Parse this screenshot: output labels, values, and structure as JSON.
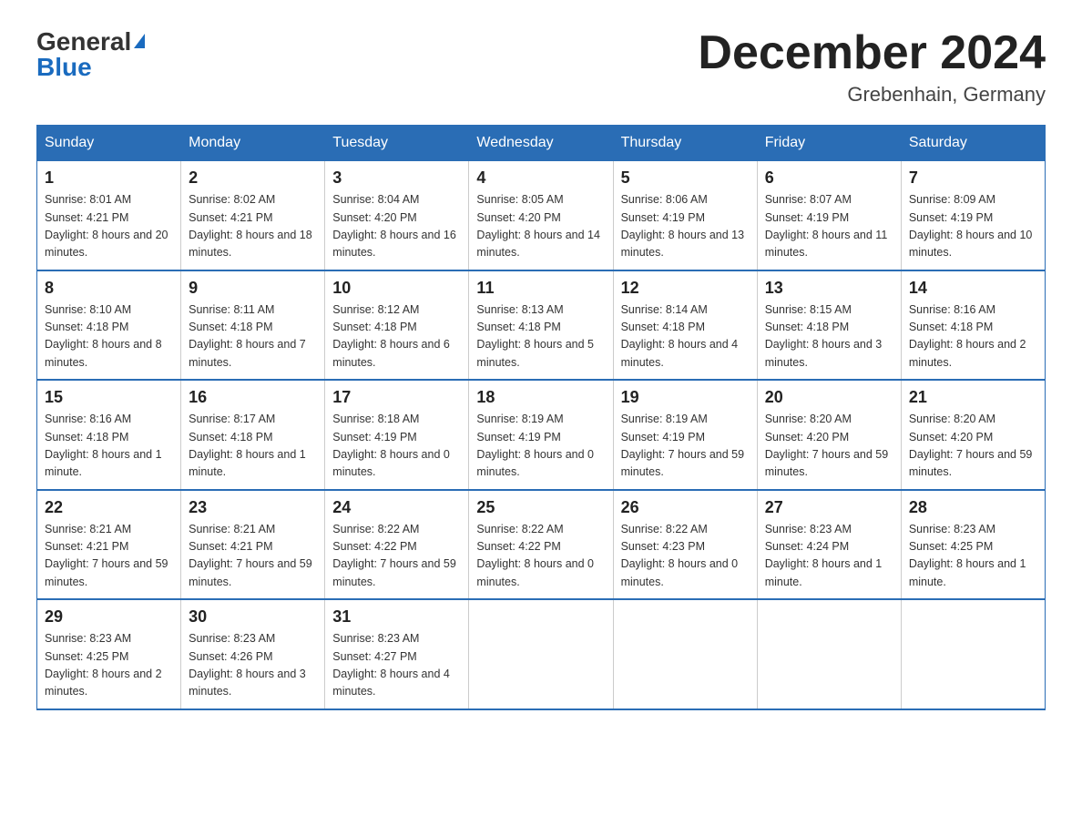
{
  "header": {
    "logo_general": "General",
    "logo_blue": "Blue",
    "month_title": "December 2024",
    "location": "Grebenhain, Germany"
  },
  "days_of_week": [
    "Sunday",
    "Monday",
    "Tuesday",
    "Wednesday",
    "Thursday",
    "Friday",
    "Saturday"
  ],
  "weeks": [
    [
      {
        "day": "1",
        "sunrise": "8:01 AM",
        "sunset": "4:21 PM",
        "daylight": "8 hours and 20 minutes."
      },
      {
        "day": "2",
        "sunrise": "8:02 AM",
        "sunset": "4:21 PM",
        "daylight": "8 hours and 18 minutes."
      },
      {
        "day": "3",
        "sunrise": "8:04 AM",
        "sunset": "4:20 PM",
        "daylight": "8 hours and 16 minutes."
      },
      {
        "day": "4",
        "sunrise": "8:05 AM",
        "sunset": "4:20 PM",
        "daylight": "8 hours and 14 minutes."
      },
      {
        "day": "5",
        "sunrise": "8:06 AM",
        "sunset": "4:19 PM",
        "daylight": "8 hours and 13 minutes."
      },
      {
        "day": "6",
        "sunrise": "8:07 AM",
        "sunset": "4:19 PM",
        "daylight": "8 hours and 11 minutes."
      },
      {
        "day": "7",
        "sunrise": "8:09 AM",
        "sunset": "4:19 PM",
        "daylight": "8 hours and 10 minutes."
      }
    ],
    [
      {
        "day": "8",
        "sunrise": "8:10 AM",
        "sunset": "4:18 PM",
        "daylight": "8 hours and 8 minutes."
      },
      {
        "day": "9",
        "sunrise": "8:11 AM",
        "sunset": "4:18 PM",
        "daylight": "8 hours and 7 minutes."
      },
      {
        "day": "10",
        "sunrise": "8:12 AM",
        "sunset": "4:18 PM",
        "daylight": "8 hours and 6 minutes."
      },
      {
        "day": "11",
        "sunrise": "8:13 AM",
        "sunset": "4:18 PM",
        "daylight": "8 hours and 5 minutes."
      },
      {
        "day": "12",
        "sunrise": "8:14 AM",
        "sunset": "4:18 PM",
        "daylight": "8 hours and 4 minutes."
      },
      {
        "day": "13",
        "sunrise": "8:15 AM",
        "sunset": "4:18 PM",
        "daylight": "8 hours and 3 minutes."
      },
      {
        "day": "14",
        "sunrise": "8:16 AM",
        "sunset": "4:18 PM",
        "daylight": "8 hours and 2 minutes."
      }
    ],
    [
      {
        "day": "15",
        "sunrise": "8:16 AM",
        "sunset": "4:18 PM",
        "daylight": "8 hours and 1 minute."
      },
      {
        "day": "16",
        "sunrise": "8:17 AM",
        "sunset": "4:18 PM",
        "daylight": "8 hours and 1 minute."
      },
      {
        "day": "17",
        "sunrise": "8:18 AM",
        "sunset": "4:19 PM",
        "daylight": "8 hours and 0 minutes."
      },
      {
        "day": "18",
        "sunrise": "8:19 AM",
        "sunset": "4:19 PM",
        "daylight": "8 hours and 0 minutes."
      },
      {
        "day": "19",
        "sunrise": "8:19 AM",
        "sunset": "4:19 PM",
        "daylight": "7 hours and 59 minutes."
      },
      {
        "day": "20",
        "sunrise": "8:20 AM",
        "sunset": "4:20 PM",
        "daylight": "7 hours and 59 minutes."
      },
      {
        "day": "21",
        "sunrise": "8:20 AM",
        "sunset": "4:20 PM",
        "daylight": "7 hours and 59 minutes."
      }
    ],
    [
      {
        "day": "22",
        "sunrise": "8:21 AM",
        "sunset": "4:21 PM",
        "daylight": "7 hours and 59 minutes."
      },
      {
        "day": "23",
        "sunrise": "8:21 AM",
        "sunset": "4:21 PM",
        "daylight": "7 hours and 59 minutes."
      },
      {
        "day": "24",
        "sunrise": "8:22 AM",
        "sunset": "4:22 PM",
        "daylight": "7 hours and 59 minutes."
      },
      {
        "day": "25",
        "sunrise": "8:22 AM",
        "sunset": "4:22 PM",
        "daylight": "8 hours and 0 minutes."
      },
      {
        "day": "26",
        "sunrise": "8:22 AM",
        "sunset": "4:23 PM",
        "daylight": "8 hours and 0 minutes."
      },
      {
        "day": "27",
        "sunrise": "8:23 AM",
        "sunset": "4:24 PM",
        "daylight": "8 hours and 1 minute."
      },
      {
        "day": "28",
        "sunrise": "8:23 AM",
        "sunset": "4:25 PM",
        "daylight": "8 hours and 1 minute."
      }
    ],
    [
      {
        "day": "29",
        "sunrise": "8:23 AM",
        "sunset": "4:25 PM",
        "daylight": "8 hours and 2 minutes."
      },
      {
        "day": "30",
        "sunrise": "8:23 AM",
        "sunset": "4:26 PM",
        "daylight": "8 hours and 3 minutes."
      },
      {
        "day": "31",
        "sunrise": "8:23 AM",
        "sunset": "4:27 PM",
        "daylight": "8 hours and 4 minutes."
      },
      null,
      null,
      null,
      null
    ]
  ],
  "labels": {
    "sunrise": "Sunrise:",
    "sunset": "Sunset:",
    "daylight": "Daylight:"
  }
}
